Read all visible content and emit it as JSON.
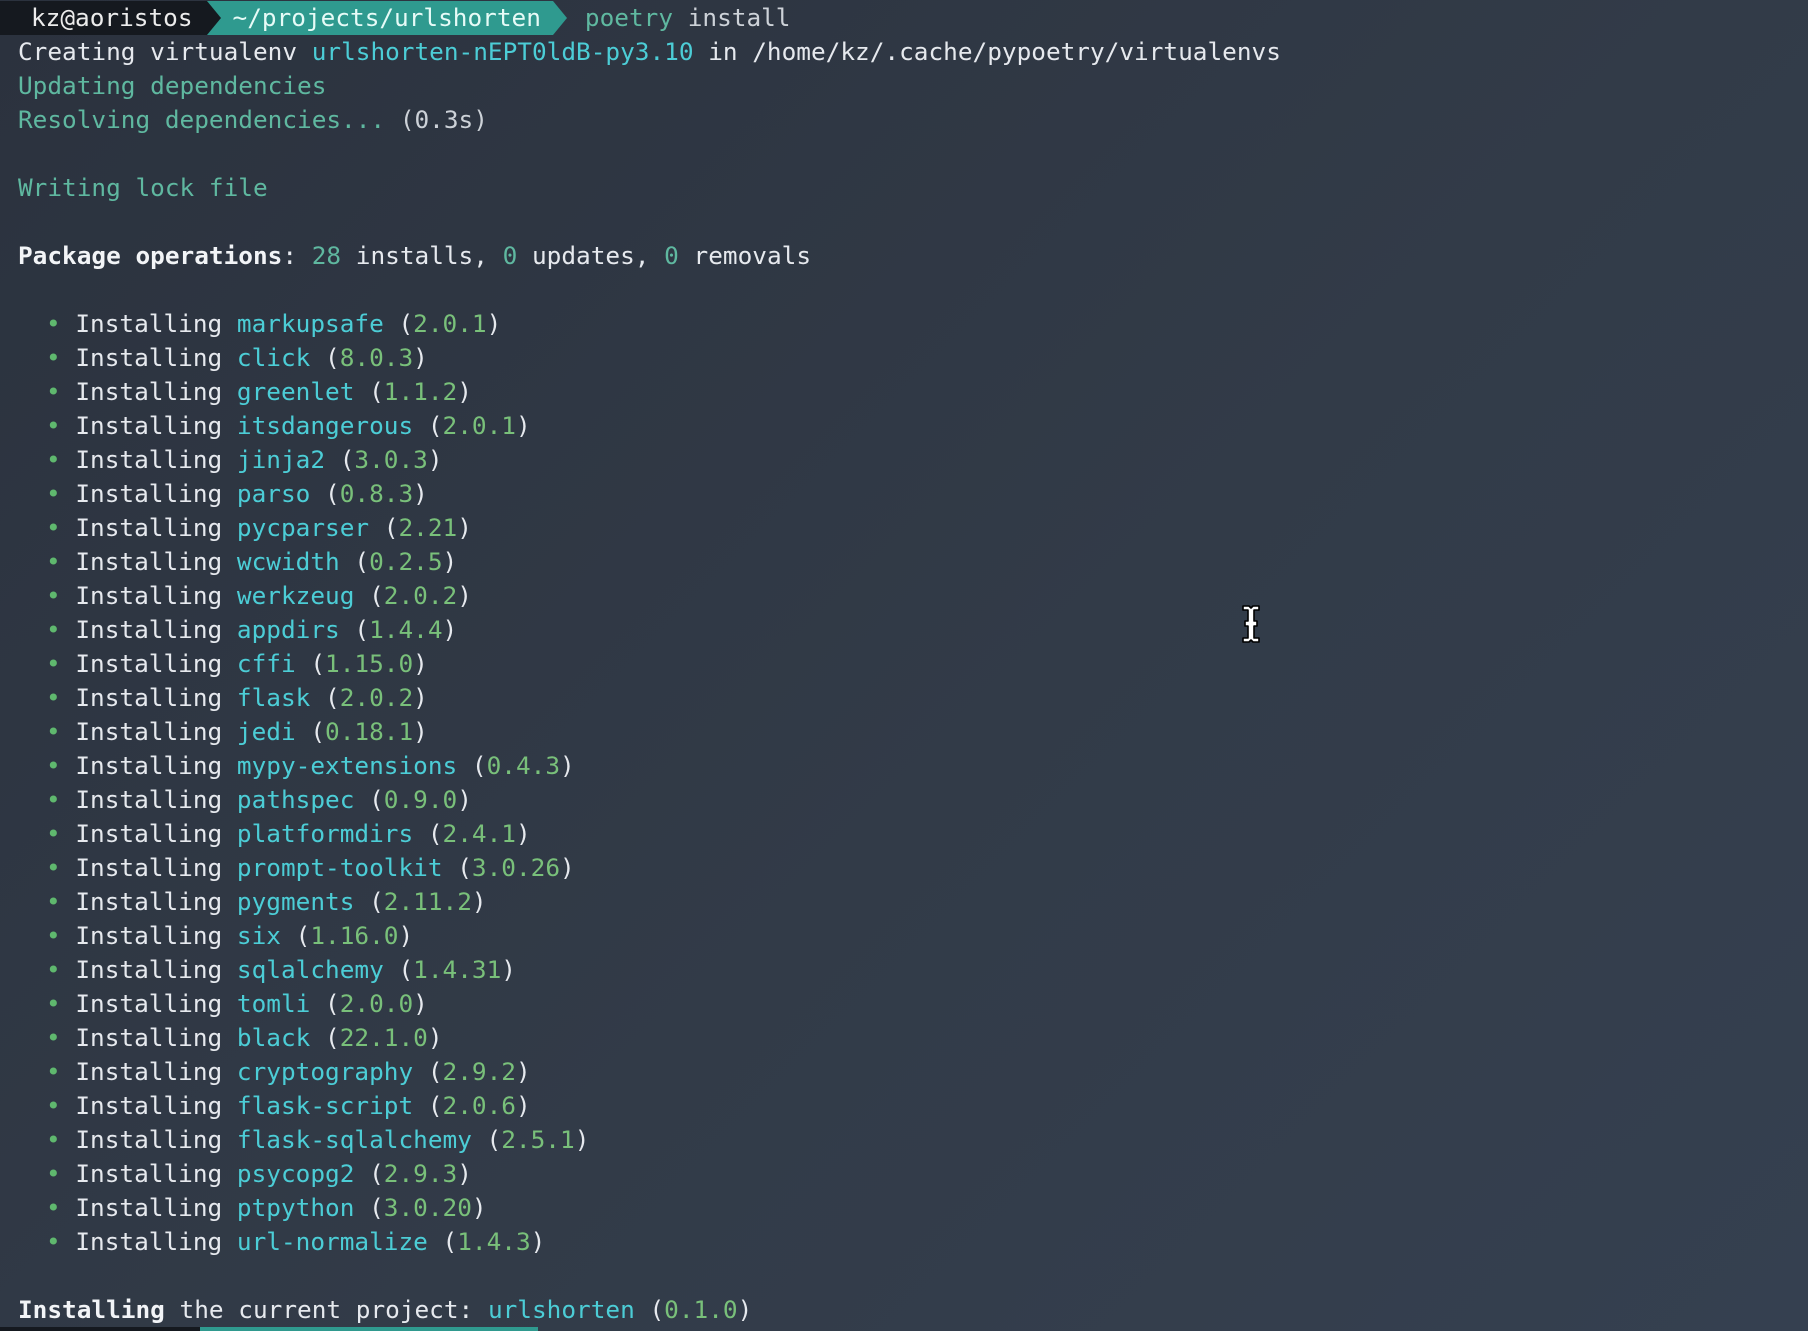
{
  "prompt": {
    "user_host": "kz@aoristos",
    "path": "~/projects/urlshorten",
    "command_name": "poetry",
    "command_args": "install"
  },
  "venv": {
    "prefix": "Creating virtualenv",
    "name": "urlshorten-nEPT0ldB-py3.10",
    "middle": "in",
    "location": "/home/kz/.cache/pypoetry/virtualenvs"
  },
  "updating": "Updating dependencies",
  "resolving": {
    "text": "Resolving dependencies...",
    "time": "(0.3s)"
  },
  "writing": "Writing lock file",
  "operations": {
    "label": "Package operations",
    "colon": ":",
    "installs_count": "28",
    "installs_label": "installs,",
    "updates_count": "0",
    "updates_label": "updates,",
    "removals_count": "0",
    "removals_label": "removals"
  },
  "install_verb": "Installing",
  "bullet_char": "•",
  "packages": [
    {
      "name": "markupsafe",
      "version": "2.0.1"
    },
    {
      "name": "click",
      "version": "8.0.3"
    },
    {
      "name": "greenlet",
      "version": "1.1.2"
    },
    {
      "name": "itsdangerous",
      "version": "2.0.1"
    },
    {
      "name": "jinja2",
      "version": "3.0.3"
    },
    {
      "name": "parso",
      "version": "0.8.3"
    },
    {
      "name": "pycparser",
      "version": "2.21"
    },
    {
      "name": "wcwidth",
      "version": "0.2.5"
    },
    {
      "name": "werkzeug",
      "version": "2.0.2"
    },
    {
      "name": "appdirs",
      "version": "1.4.4"
    },
    {
      "name": "cffi",
      "version": "1.15.0"
    },
    {
      "name": "flask",
      "version": "2.0.2"
    },
    {
      "name": "jedi",
      "version": "0.18.1"
    },
    {
      "name": "mypy-extensions",
      "version": "0.4.3"
    },
    {
      "name": "pathspec",
      "version": "0.9.0"
    },
    {
      "name": "platformdirs",
      "version": "2.4.1"
    },
    {
      "name": "prompt-toolkit",
      "version": "3.0.26"
    },
    {
      "name": "pygments",
      "version": "2.11.2"
    },
    {
      "name": "six",
      "version": "1.16.0"
    },
    {
      "name": "sqlalchemy",
      "version": "1.4.31"
    },
    {
      "name": "tomli",
      "version": "2.0.0"
    },
    {
      "name": "black",
      "version": "22.1.0"
    },
    {
      "name": "cryptography",
      "version": "2.9.2"
    },
    {
      "name": "flask-script",
      "version": "2.0.6"
    },
    {
      "name": "flask-sqlalchemy",
      "version": "2.5.1"
    },
    {
      "name": "psycopg2",
      "version": "2.9.3"
    },
    {
      "name": "ptpython",
      "version": "3.0.20"
    },
    {
      "name": "url-normalize",
      "version": "1.4.3"
    }
  ],
  "current_project": {
    "bold": "Installing",
    "text": "the current project:",
    "name": "urlshorten",
    "version": "0.1.0"
  },
  "colors": {
    "background": "#303846",
    "prompt_user_bg": "#15191f",
    "prompt_path_bg": "#2f9a8f",
    "status_green": "#5fb8a0",
    "package_cyan": "#4ccdd6",
    "version_green": "#79c07a"
  },
  "icons": {
    "mouse_cursor": "text-ibeam-cursor-icon"
  }
}
